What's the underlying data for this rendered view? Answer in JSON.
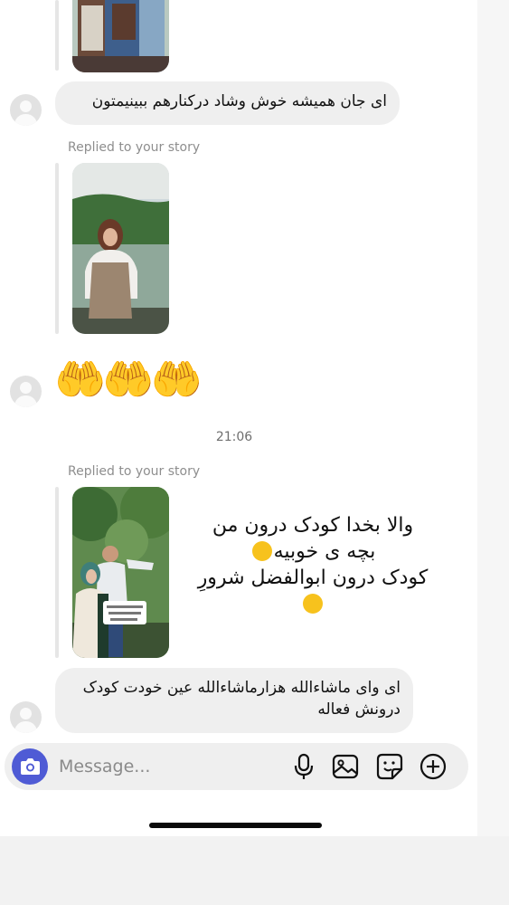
{
  "messages": {
    "m1_text": "ای جان همیشه خوش وشاد درکنارهم ببینیمتون",
    "m2_text": "ای وای ماشاءالله هزارماشاءالله عین خودت کودک درونش فعاله"
  },
  "replied_label_1": "Replied to your story",
  "replied_label_2": "Replied to your story",
  "timestamp": "21:06",
  "emoji": {
    "reaction": "🤲🤲🤲",
    "laugh_rolling": "rolling-on-floor-laughing-emoji",
    "tears_of_joy": "face-with-tears-of-joy-emoji"
  },
  "story_overlay": {
    "line1": "والا بخدا کودک درون من",
    "line2": "بچه ی خوبیه",
    "line3": "کودک درون ابوالفضل شرورِ"
  },
  "composer": {
    "placeholder": "Message..."
  },
  "colors": {
    "accent": "#4f5bd5",
    "bubble": "#efefef",
    "muted_text": "#8e8e8e"
  }
}
